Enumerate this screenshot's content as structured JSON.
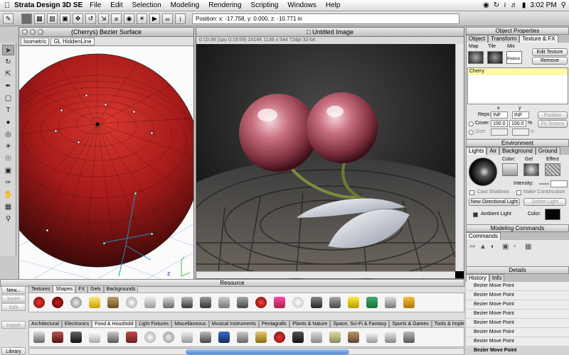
{
  "menubar": {
    "app_name": "Strata Design 3D SE",
    "items": [
      "File",
      "Edit",
      "Selection",
      "Modeling",
      "Rendering",
      "Scripting",
      "Windows",
      "Help"
    ],
    "clock": "3:02 PM"
  },
  "toolbar": {
    "position": "Position: x: -17.758, y: 0.000, z: -10.771 in"
  },
  "model_window": {
    "title": "(Cherrys) Bezier Surface",
    "view": "Isometric",
    "render_mode": "GL HiddenLine",
    "axis_z": "z"
  },
  "render_window": {
    "title": "Untitled Image",
    "info": "0:10:39   (cpu 0:19:59)   2414K   1136 x 544   72dpi   32-bit"
  },
  "object_properties": {
    "title": "Object Properties",
    "tabs": [
      "Object",
      "Transform",
      "Texture & FX"
    ],
    "active_tab": "Texture & FX",
    "map_label": "Map",
    "tile_label": "Tile",
    "mix_label": "Mix",
    "replace_label": "Replace",
    "edit_texture": "Edit Texture",
    "remove": "Remove",
    "texture_list": [
      "Cherry"
    ],
    "x_label": "x",
    "y_label": "y",
    "reps_label": "Reps:",
    "reps_x": "INF",
    "reps_y": "INF",
    "position_btn": "Position",
    "cover_label": "Cover:",
    "cover_x": "100.0",
    "cover_y": "100.0",
    "pct": "%",
    "fit_texture": "Fit Texture",
    "size_label": "Size:",
    "size_unit": "in"
  },
  "environment": {
    "title": "Environment",
    "tabs": [
      "Lights",
      "Air",
      "Background",
      "Ground"
    ],
    "active_tab": "Lights",
    "color_label": "Color:",
    "gel_label": "Gel",
    "effect_label": "Effect",
    "intensity_label": "Intensity:",
    "cast_shadows": "Cast Shadows",
    "make_construction": "Make Construction",
    "new_directional_light": "New Directional Light",
    "delete_light": "Delete Light",
    "ambient_light": "Ambient Light",
    "ambient_color_label": "Color:"
  },
  "modeling_commands": {
    "title": "Modeling Commands",
    "tab": "Commands"
  },
  "details": {
    "title": "Details",
    "tabs": [
      "History",
      "Info"
    ],
    "active_tab": "History",
    "history": [
      "Bezier Move Point",
      "Bezier Move Point",
      "Bezier Move Point",
      "Bezier Move Point",
      "Bezier Move Point",
      "Bezier Move Point",
      "Bezier Move Point",
      "Bezier Move Point"
    ]
  },
  "resource": {
    "title": "Resource",
    "buttons": [
      "New...",
      "Insert",
      "Edit",
      "Import",
      "Library"
    ],
    "tabs_top": [
      "Textures",
      "Shapes",
      "FX",
      "Gels",
      "Backgrounds"
    ],
    "active_top": "Shapes",
    "tabs_bottom": [
      "Architectural",
      "Electronics",
      "Food & Houshold",
      "Light Fixtures",
      "Miscellaneous",
      "Musical Instruments",
      "Pentagrafic",
      "Plants & Nature",
      "Space, Sci-Fi & Fantasy",
      "Sports & Games",
      "Tools & Imple"
    ],
    "active_bottom": "Food & Houshold"
  }
}
